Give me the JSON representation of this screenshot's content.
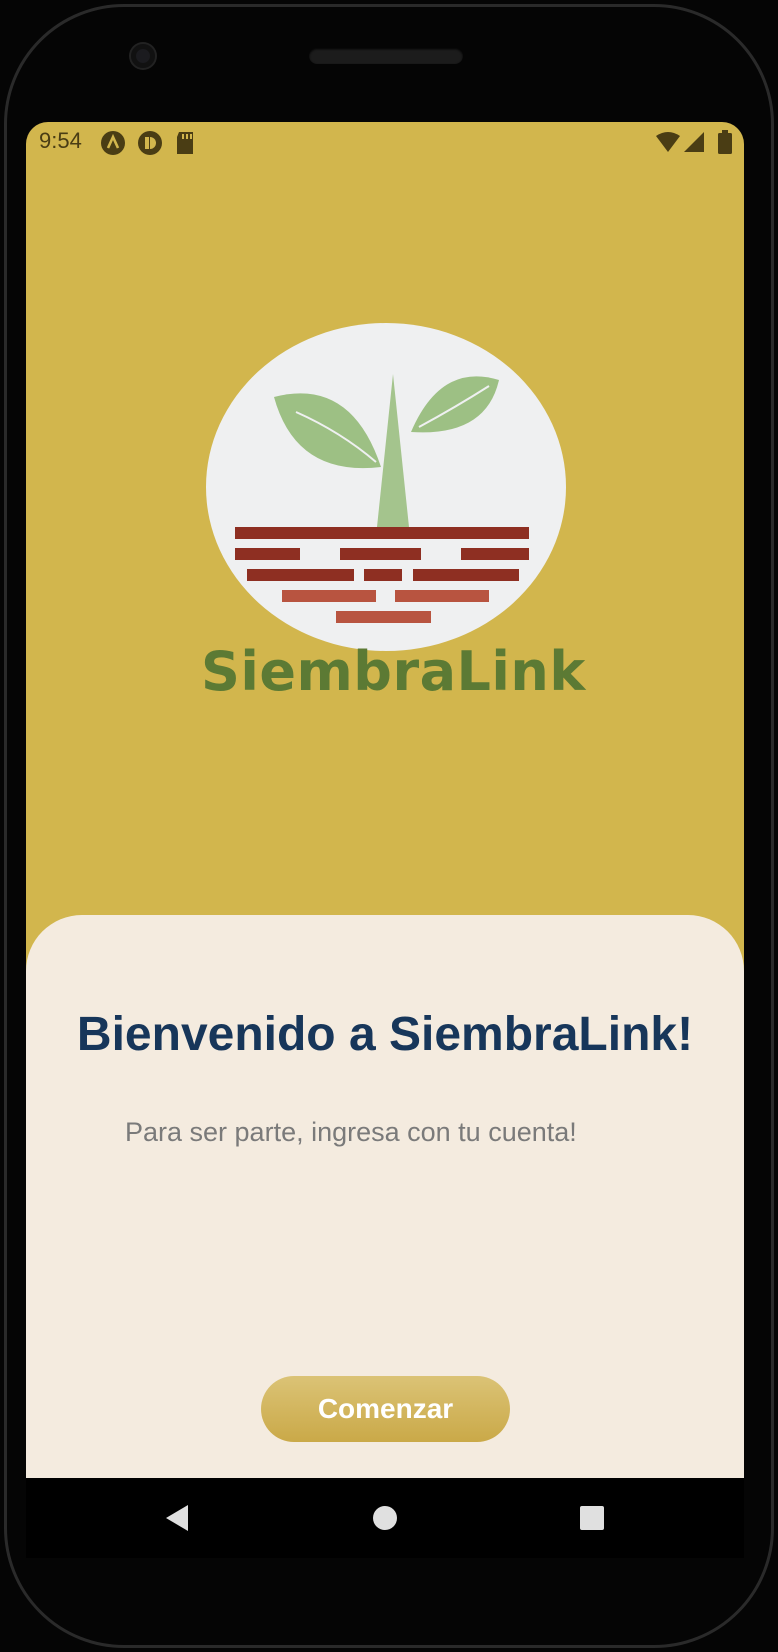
{
  "status_bar": {
    "time": "9:54",
    "icons": [
      "app-notification-icon",
      "app-notification-icon-2",
      "sd-card-icon",
      "wifi-icon",
      "cell-signal-icon",
      "battery-icon"
    ]
  },
  "logo": {
    "wordmark": "SiembraLink",
    "colors": {
      "circle": "#eff0f1",
      "leaf": "#9dc084",
      "stem": "#a4c48d",
      "brick_dark": "#8e2f22",
      "brick_light": "#b85440",
      "wordmark": "#5c7a34"
    }
  },
  "welcome": {
    "title": "Bienvenido a SiembraLink!",
    "subtitle": "Para ser parte, ingresa con tu cuenta!",
    "button_label": "Comenzar"
  },
  "nav_bar": {
    "buttons": [
      "back-icon",
      "home-icon",
      "recents-icon"
    ]
  },
  "colors": {
    "background": "#d2b64d",
    "sheet": "#f4ebdf",
    "title": "#17365a",
    "subtitle": "#7a7a7a",
    "button": "#caa948"
  }
}
